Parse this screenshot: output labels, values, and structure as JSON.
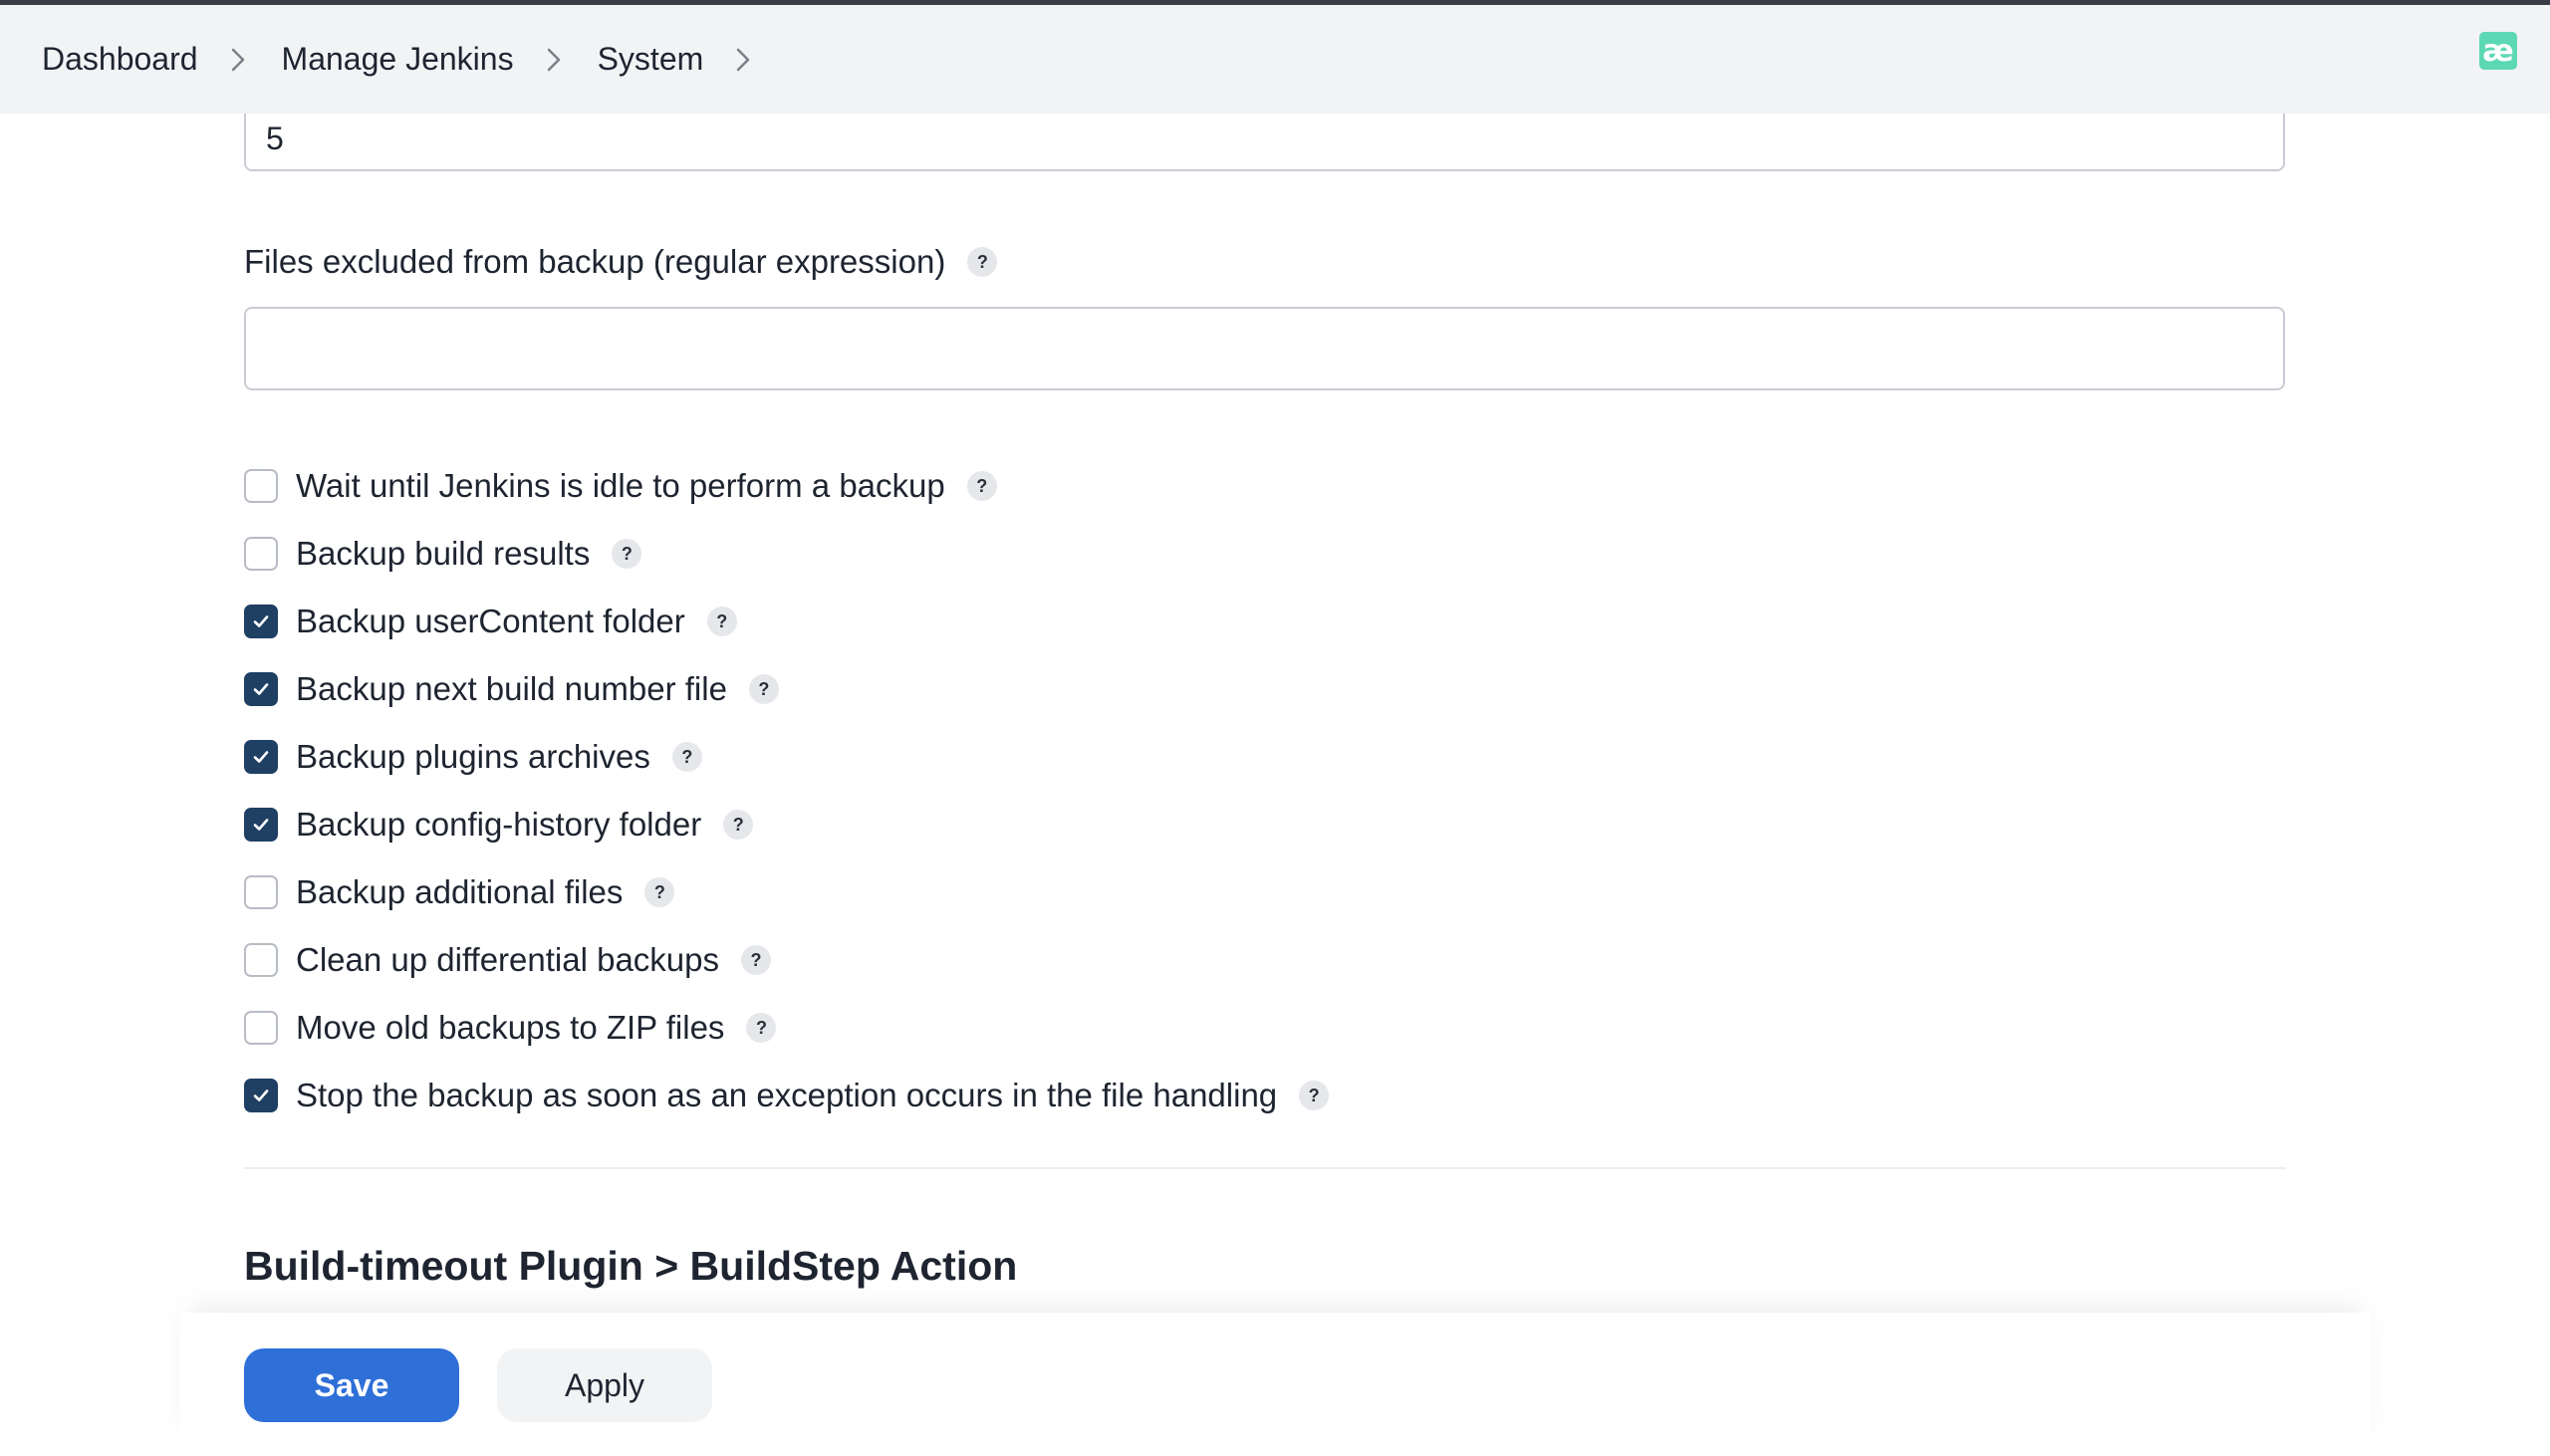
{
  "breadcrumb": [
    {
      "label": "Dashboard"
    },
    {
      "label": "Manage Jenkins"
    },
    {
      "label": "System"
    }
  ],
  "app_icon": {
    "glyph": "æ",
    "color": "#5dd8b5",
    "name": "app-badge-icon"
  },
  "form": {
    "top_field_value": "5",
    "excluded_label": "Files excluded from backup (regular expression)",
    "excluded_value": "",
    "help_glyph": "?",
    "options": [
      {
        "label": "Wait until Jenkins is idle to perform a backup",
        "checked": false
      },
      {
        "label": "Backup build results",
        "checked": false
      },
      {
        "label": "Backup userContent folder",
        "checked": true
      },
      {
        "label": "Backup next build number file",
        "checked": true
      },
      {
        "label": "Backup plugins archives",
        "checked": true
      },
      {
        "label": "Backup config-history folder",
        "checked": true
      },
      {
        "label": "Backup additional files",
        "checked": false
      },
      {
        "label": "Clean up differential backups",
        "checked": false
      },
      {
        "label": "Move old backups to ZIP files",
        "checked": false
      },
      {
        "label": "Stop the backup as soon as an exception occurs in the file handling",
        "checked": true
      }
    ]
  },
  "section": {
    "title": "Build-timeout Plugin > BuildStep Action"
  },
  "footer": {
    "save_label": "Save",
    "apply_label": "Apply"
  },
  "colors": {
    "accent": "#2f6fd8",
    "checkbox_checked": "#1f3f63",
    "header_bg": "#f2f3f5"
  }
}
